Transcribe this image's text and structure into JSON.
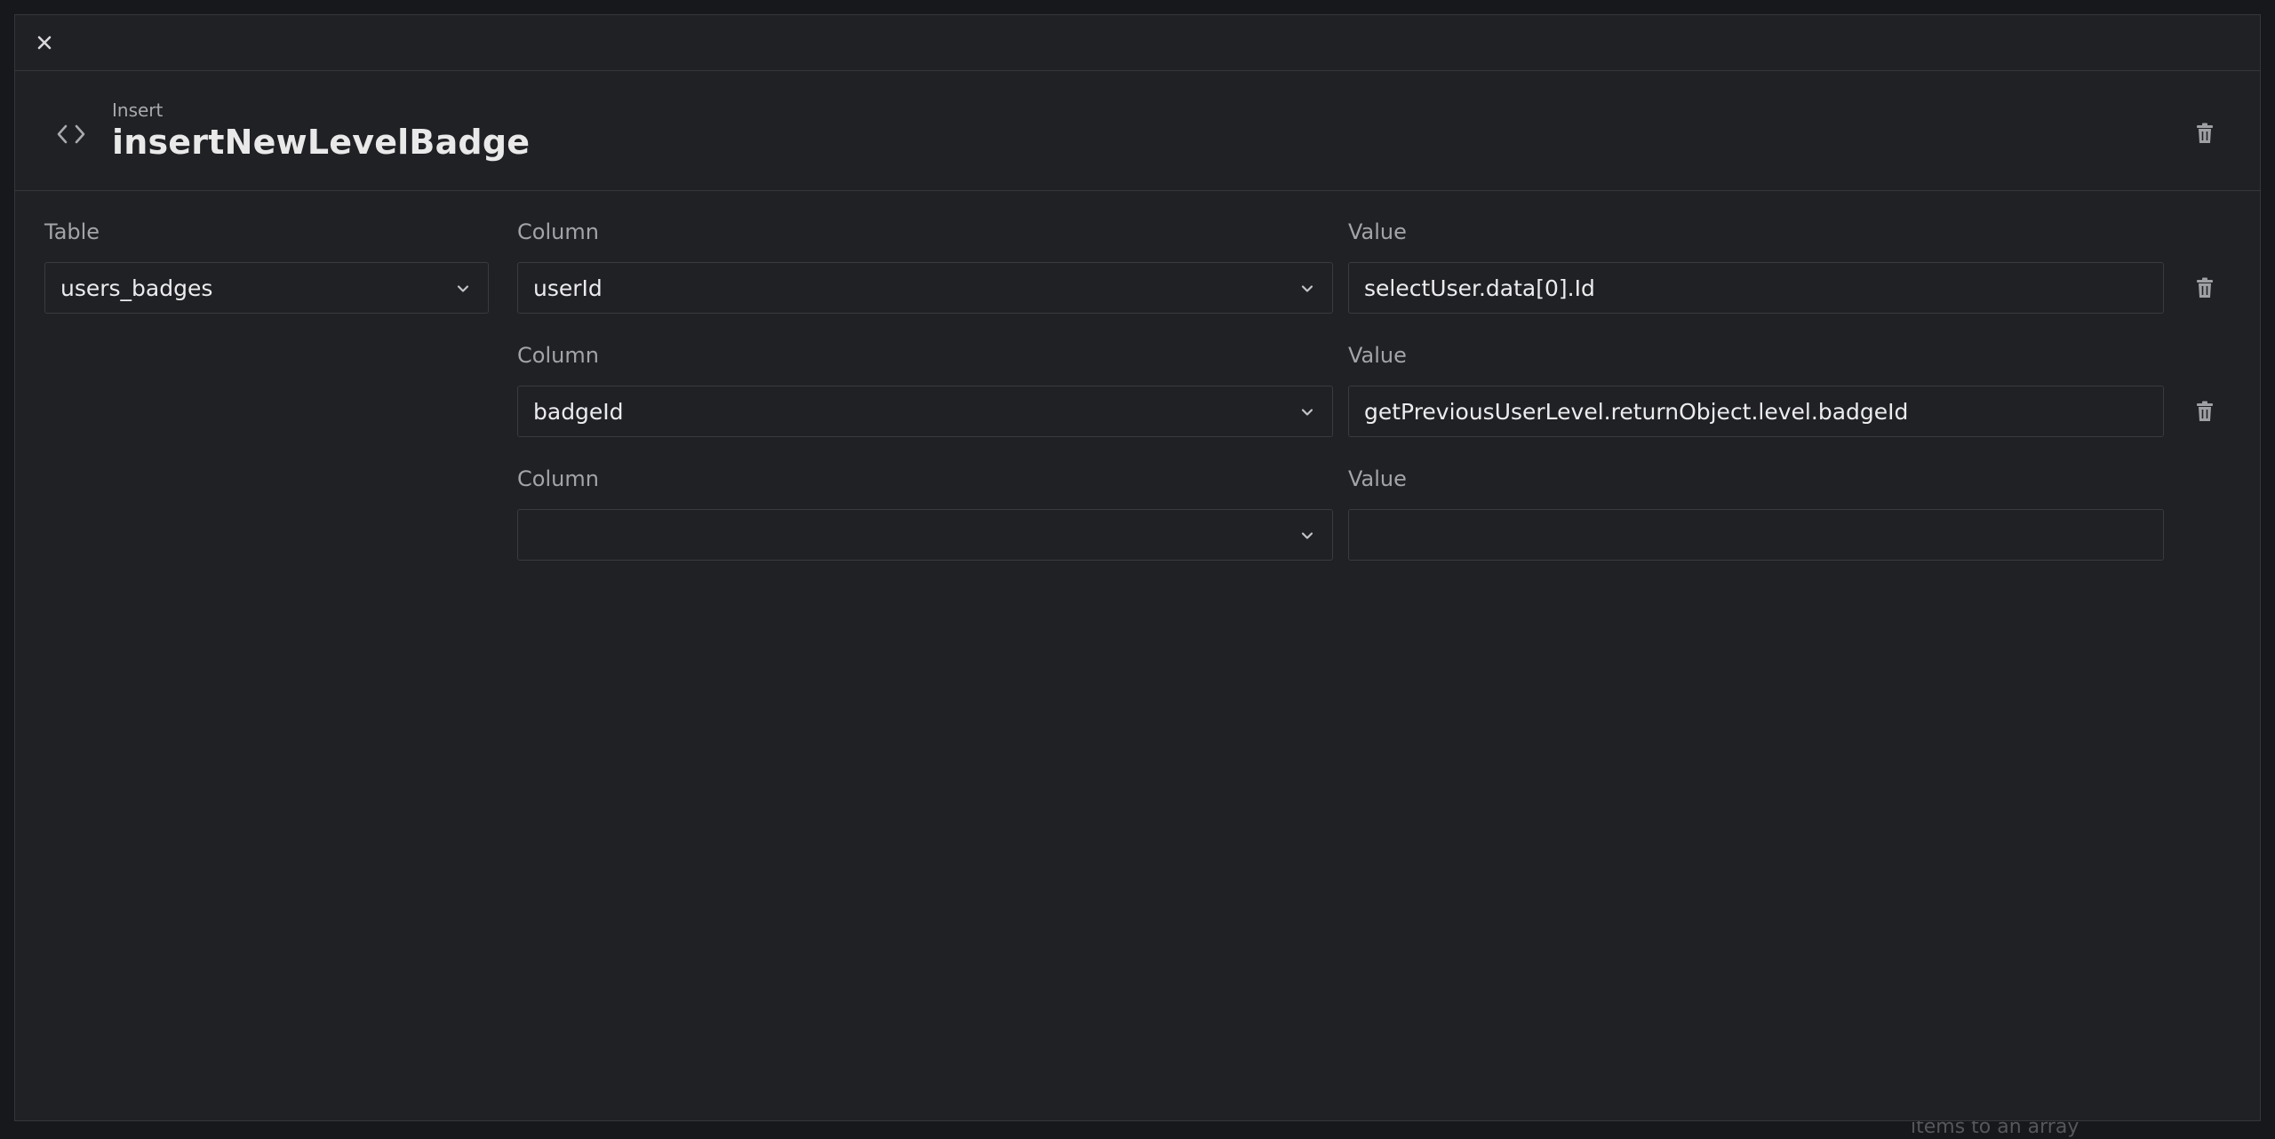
{
  "background_hint": "items to an array",
  "topbar": {
    "close_icon": "close-icon"
  },
  "header": {
    "kind": "Insert",
    "title": "insertNewLevelBadge",
    "icon": "code-icon",
    "delete_icon": "trash-icon"
  },
  "table": {
    "label": "Table",
    "value": "users_badges"
  },
  "rows": [
    {
      "column_label": "Column",
      "column_value": "userId",
      "value_label": "Value",
      "value": "selectUser.data[0].Id"
    },
    {
      "column_label": "Column",
      "column_value": "badgeId",
      "value_label": "Value",
      "value": "getPreviousUserLevel.returnObject.level.badgeId"
    },
    {
      "column_label": "Column",
      "column_value": "",
      "value_label": "Value",
      "value": ""
    }
  ],
  "colors": {
    "modal_bg": "#202124",
    "page_bg": "#17181b",
    "border": "#35363b",
    "text": "#e6e6e8",
    "muted": "#a3a4a8"
  }
}
